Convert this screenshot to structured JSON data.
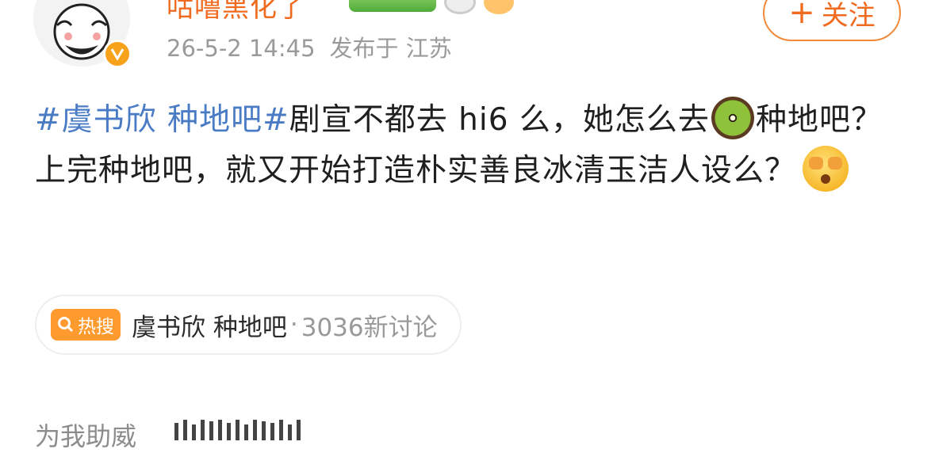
{
  "post": {
    "username": "咕噜黑化了",
    "timestamp": "26-5-2 14:45",
    "location": "发布于 江苏",
    "follow_label": "关注",
    "hashtag": "#虞书欣 种地吧#",
    "text_part1": "剧宣不都去 hi6 么，她怎么去",
    "text_part2": "种地吧？上完种地吧，就又开始打造朴实善良冰清玉洁人设么？"
  },
  "hot_search": {
    "badge_label": "热搜",
    "topic": "虞书欣 种地吧",
    "count": "3036新讨论"
  },
  "footer": {
    "support_label": "为我助威"
  },
  "colors": {
    "accent": "#f06a1f",
    "hashtag": "#4a7bc5",
    "hot_badge": "#ff9a2e"
  },
  "icons": [
    "avatar",
    "verified-badge-icon",
    "kiwi-emoji-icon",
    "cover-face-emoji-icon",
    "search-icon"
  ]
}
